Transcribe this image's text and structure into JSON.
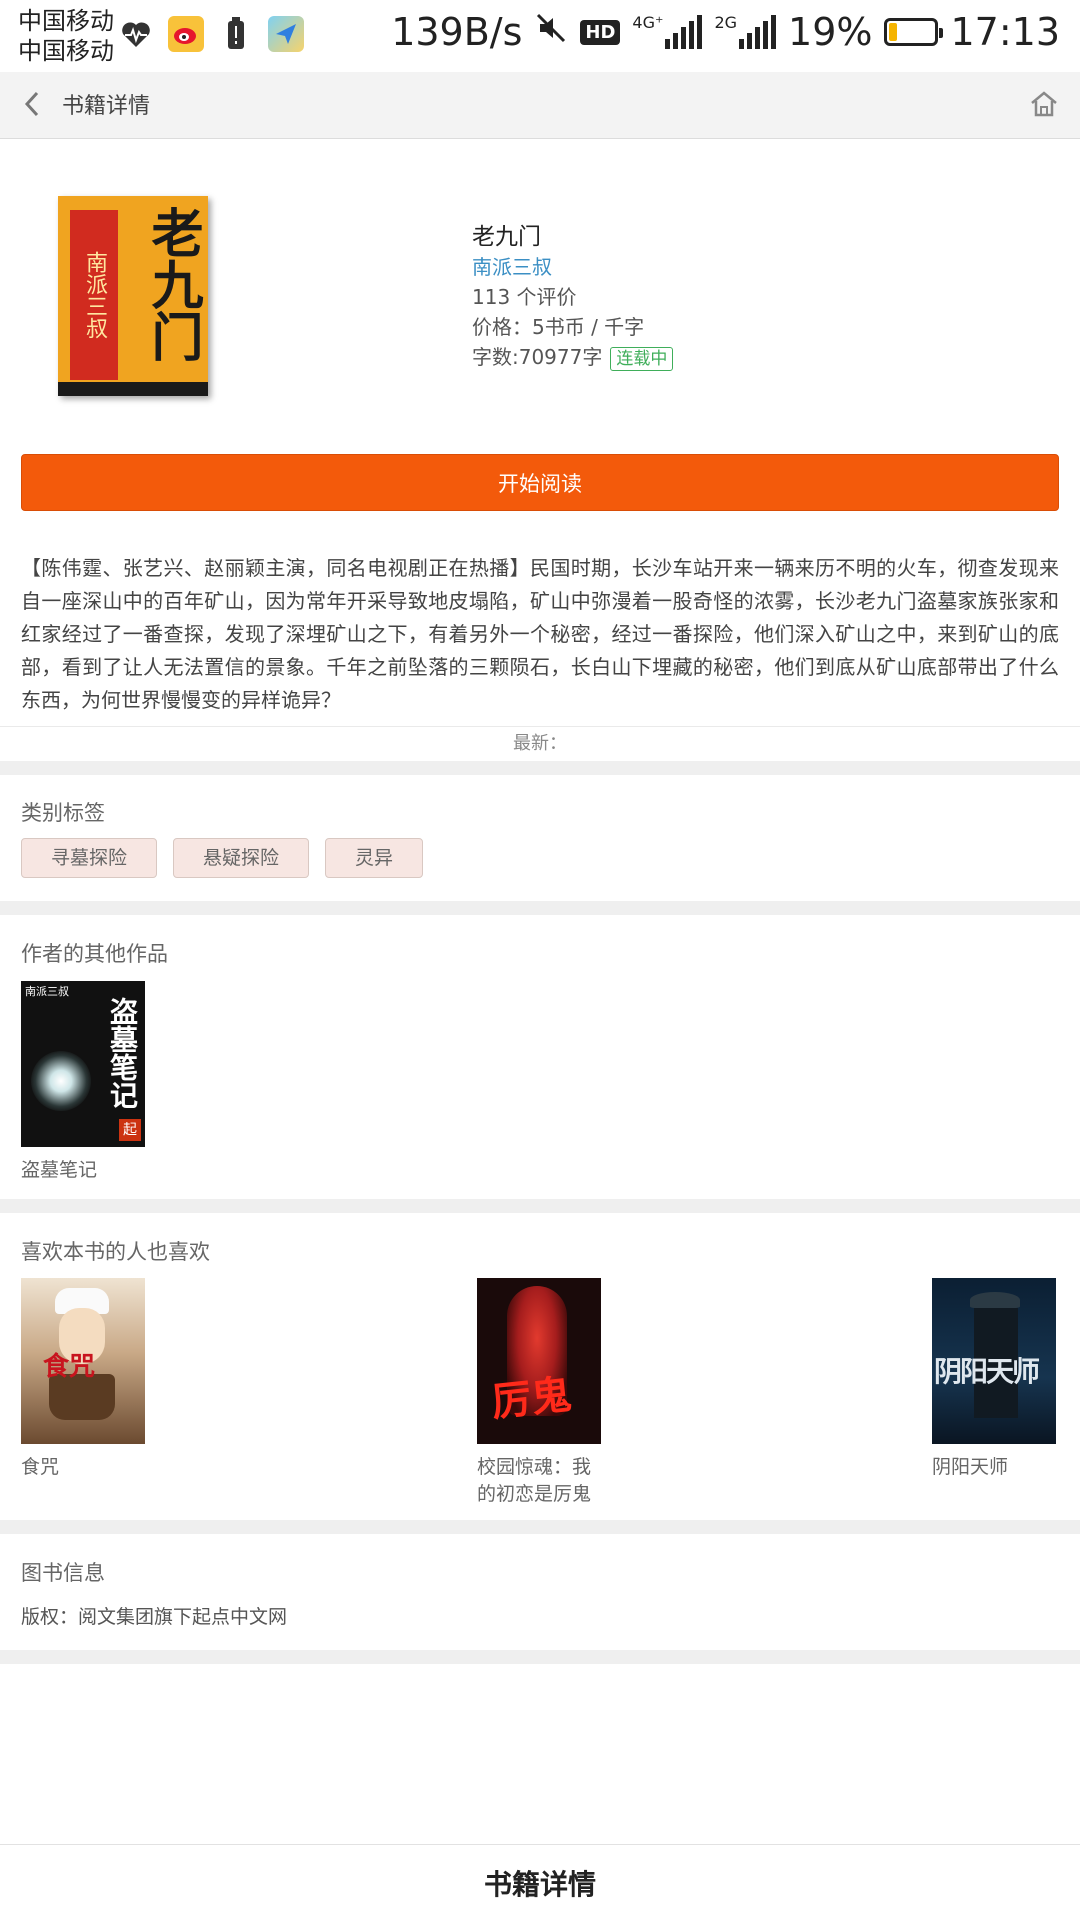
{
  "status_bar": {
    "carrier_1": "中国移动",
    "carrier_2": "中国移动",
    "net_speed": "139B/s",
    "hd": "HD",
    "net_4g": "4G⁺",
    "net_2g": "2G",
    "battery": "19%",
    "battery_level": 0.19,
    "time": "17:13"
  },
  "nav": {
    "title": "书籍详情",
    "back_icon": "chevron-left-icon",
    "home_icon": "home-icon"
  },
  "book": {
    "title": "老九门",
    "author": "南派三叔",
    "reviews": "113 个评价",
    "price": "价格：5书币 / 千字",
    "word_count": "字数:70977字",
    "status": "连载中",
    "read_button": "开始阅读",
    "description": "【陈伟霆、张艺兴、赵丽颖主演，同名电视剧正在热播】民国时期，长沙车站开来一辆来历不明的火车，彻查发现来自一座深山中的百年矿山，因为常年开采导致地皮塌陷，矿山中弥漫着一股奇怪的浓雾，长沙老九门盗墓家族张家和红家经过了一番查探，发现了深埋矿山之下，有着另外一个秘密，经过一番探险，他们深入矿山之中，来到矿山的底部，看到了让人无法置信的景象。千年之前坠落的三颗陨石，长白山下埋藏的秘密，他们到底从矿山底部带出了什么东西，为何世界慢慢变的异样诡异？",
    "latest": "最新："
  },
  "cover_main": {
    "side_text": "南派三叔",
    "big_text": "老九门"
  },
  "categories": {
    "title": "类别标签",
    "tags": [
      "寻墓探险",
      "悬疑探险",
      "灵异"
    ]
  },
  "other_works": {
    "title": "作者的其他作品",
    "items": [
      {
        "name": "盗墓笔记",
        "cover_text": "盗墓笔记",
        "cover_small": "南派三叔",
        "mark": "起"
      }
    ]
  },
  "also_like": {
    "title": "喜欢本书的人也喜欢",
    "items": [
      {
        "name": "食咒",
        "cover_text": "食咒"
      },
      {
        "name": "校园惊魂：我的初恋是厉鬼",
        "cover_text": "厉鬼"
      },
      {
        "name": "阴阳天师",
        "cover_text": "阴阳天师"
      }
    ]
  },
  "book_info": {
    "title": "图书信息",
    "copyright": "版权：阅文集团旗下起点中文网"
  },
  "bottom_bar": {
    "title": "书籍详情"
  },
  "colors": {
    "accent": "#f35a0b",
    "author_link": "#3b8fc4",
    "status_green": "#3fae5a"
  }
}
